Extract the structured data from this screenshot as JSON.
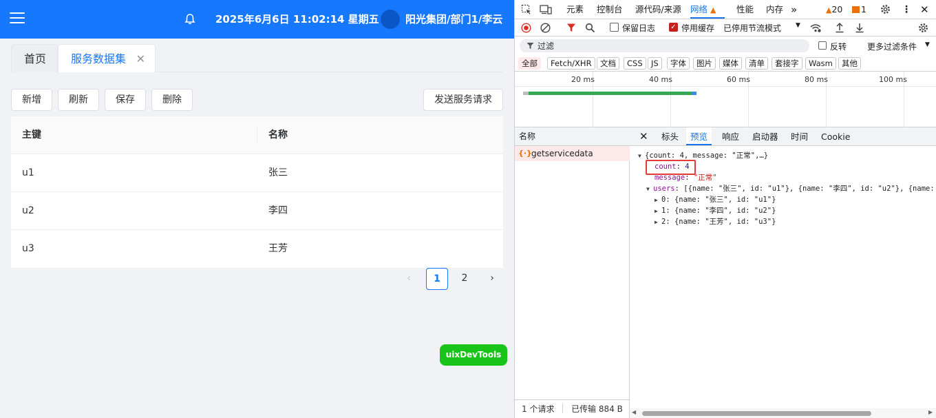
{
  "header": {
    "datetime": "2025年6月6日 11:02:14 星期五",
    "user": "阳光集团/部门1/李云"
  },
  "tabs": [
    {
      "label": "首页"
    },
    {
      "label": "服务数据集"
    }
  ],
  "toolbar": {
    "add": "新增",
    "refresh": "刷新",
    "save": "保存",
    "delete": "删除",
    "send_request": "发送服务请求"
  },
  "table": {
    "columns": [
      "主键",
      "名称"
    ],
    "rows": [
      {
        "id": "u1",
        "name": "张三"
      },
      {
        "id": "u2",
        "name": "李四"
      },
      {
        "id": "u3",
        "name": "王芳"
      }
    ]
  },
  "pagination": {
    "pages": [
      "1",
      "2"
    ],
    "current": "1"
  },
  "floating_button": "uixDevTools",
  "devtools": {
    "tabs": [
      "元素",
      "控制台",
      "源代码/来源",
      "网络",
      "性能",
      "内存"
    ],
    "warnings": "20",
    "errors": "1",
    "toolbar": {
      "preserve_log": "保留日志",
      "disable_cache": "停用缓存",
      "throttle": "已停用节流模式"
    },
    "filter": {
      "placeholder": "过滤",
      "invert": "反转",
      "more": "更多过滤条件"
    },
    "types": [
      "全部",
      "Fetch/XHR",
      "文档",
      "CSS",
      "JS",
      "字体",
      "图片",
      "媒体",
      "清单",
      "套接字",
      "Wasm",
      "其他"
    ],
    "timeline_ticks": [
      "20 ms",
      "40 ms",
      "60 ms",
      "80 ms",
      "100 ms"
    ],
    "name_header": "名称",
    "request_name": "getservicedata",
    "status": {
      "requests": "1 个请求",
      "transferred": "已传输 884 B"
    },
    "detail_tabs": [
      "标头",
      "预览",
      "响应",
      "启动器",
      "时间",
      "Cookie"
    ],
    "preview": {
      "summary": "{count: 4, message: \"正常\",…}",
      "count_key": "count",
      "count_value": "4",
      "message_key": "message",
      "message_value": "\"正常\"",
      "users_key": "users",
      "users_summary": "[{name: \"张三\", id: \"u1\"}, {name: \"李四\", id: \"u2\"}, {name: \"",
      "items": [
        "0: {name: \"张三\", id: \"u1\"}",
        "1: {name: \"李四\", id: \"u2\"}",
        "2: {name: \"王芳\", id: \"u3\"}"
      ]
    }
  },
  "colors": {
    "header_bg": "#1677ff",
    "accent": "#1677ff",
    "float_button": "#18c418",
    "devtools_accent": "#1a73e8",
    "highlight": "#e53935"
  }
}
